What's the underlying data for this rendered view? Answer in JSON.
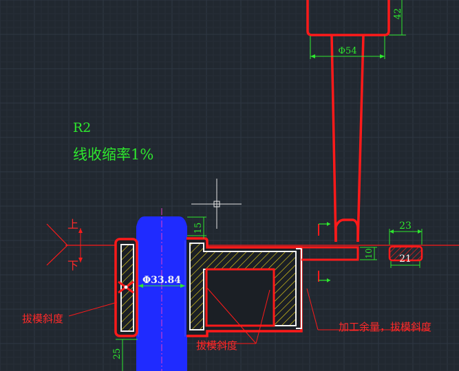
{
  "drawing": {
    "note_radius": "R2",
    "note_shrinkage": "线收缩率1%",
    "label_up": "上",
    "label_down": "下",
    "label_draft_left": "拔模斜度",
    "label_draft_bottom": "拔模斜度",
    "label_machining": "加工余量，拔模斜度",
    "dim_42": "42",
    "dim_phi54": "Φ54",
    "dim_15": "15",
    "dim_phi3384": "Φ33.84",
    "dim_25": "25",
    "dim_23": "23",
    "dim_21": "21",
    "dim_10": "10"
  },
  "colors": {
    "background": "#212830",
    "grid_major": "#2e3843",
    "grid_minor": "#262e37",
    "outline_red": "#ff1a1a",
    "core_blue": "#1f2bff",
    "section_yellow": "#e8d21a",
    "dimension_green": "#2ee82e",
    "text_red": "#ff2a2a",
    "white": "#f4f4f4",
    "centerline_magenta": "#e03cc8",
    "cursor": "#e6e6e6"
  }
}
